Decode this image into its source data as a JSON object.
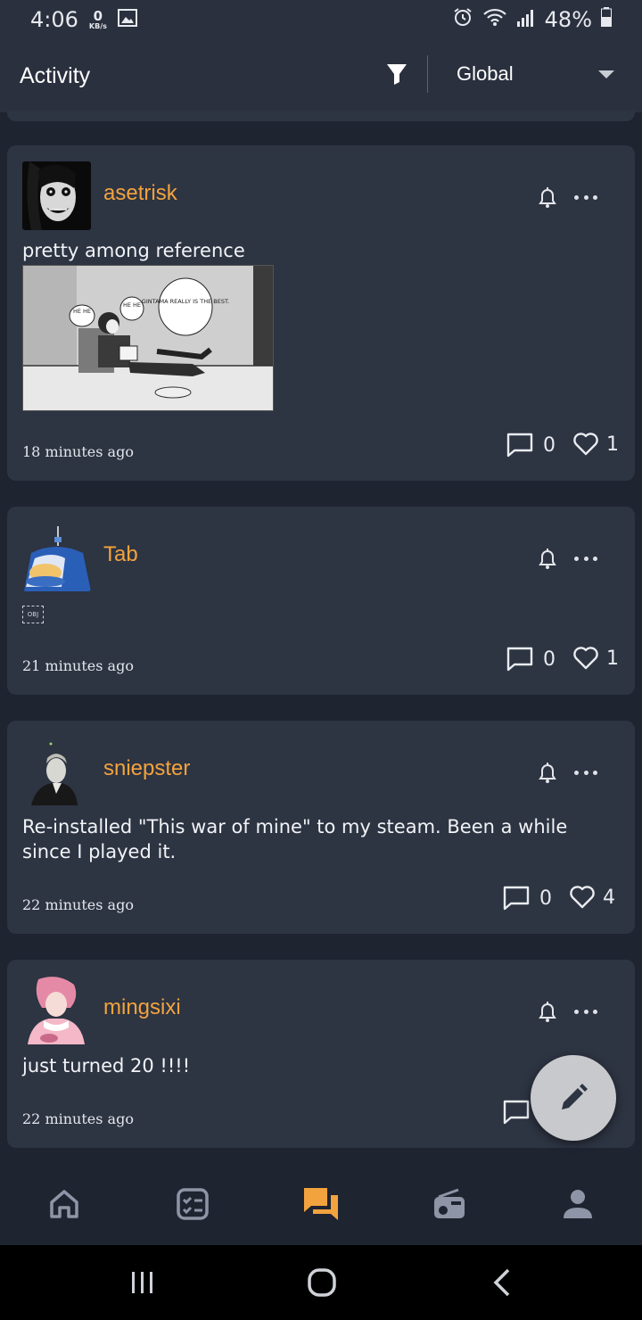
{
  "status_bar": {
    "time": "4:06",
    "net_speed_value": "0",
    "net_speed_unit": "KB/s",
    "battery_percent": "48%"
  },
  "header": {
    "title": "Activity",
    "scope_value": "Global"
  },
  "colors": {
    "accent": "#f3a33e",
    "card_bg": "#2d3442",
    "page_bg": "#1f2431"
  },
  "posts": [
    {
      "username": "asetrisk",
      "text": "pretty among reference",
      "time": "18 minutes ago",
      "replies": "0",
      "likes": "1",
      "image_bubbles": [
        "HE HE",
        "HE HE",
        "GINTAMA REALLY IS THE BEST."
      ]
    },
    {
      "username": "Tab",
      "text": "",
      "obj_placeholder": "OBJ",
      "time": "21 minutes ago",
      "replies": "0",
      "likes": "1"
    },
    {
      "username": "sniepster",
      "text": "Re-installed \"This war of mine\" to my steam. Been a while since I played it.",
      "time": "22 minutes ago",
      "replies": "0",
      "likes": "4"
    },
    {
      "username": "mingsixi",
      "text": "just turned 20 !!!!",
      "time": "22 minutes ago"
    }
  ],
  "bottom_nav": {
    "items": [
      "home-icon",
      "tasks-icon",
      "forum-icon",
      "radio-icon",
      "profile-icon"
    ],
    "active_index": 2
  },
  "fab": {
    "icon": "pencil-icon"
  }
}
